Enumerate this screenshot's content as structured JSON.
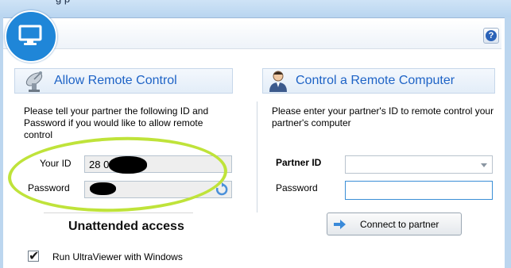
{
  "window": {
    "title_fragment": "g     p"
  },
  "help": {
    "glyph": "?"
  },
  "allow_section": {
    "title": "Allow Remote Control",
    "instructions": "Please tell your partner the following ID and Password if you would like to allow remote control",
    "your_id_label": "Your ID",
    "your_id_value": "28 0",
    "password_label": "Password",
    "password_value": ""
  },
  "control_section": {
    "title": "Control a Remote Computer",
    "instructions": "Please enter your partner's ID to remote control your partner's computer",
    "partner_id_label": "Partner ID",
    "partner_id_value": "",
    "password_label": "Password",
    "password_value": "",
    "connect_label": "Connect to partner"
  },
  "unattended": {
    "title": "Unattended access",
    "run_with_windows_label": "Run UltraViewer with Windows",
    "run_with_windows_checked": true,
    "check_glyph": "✔"
  },
  "colors": {
    "accent": "#1e63c6",
    "logo": "#1f86d8",
    "highlight_ellipse": "#bfe33a"
  }
}
